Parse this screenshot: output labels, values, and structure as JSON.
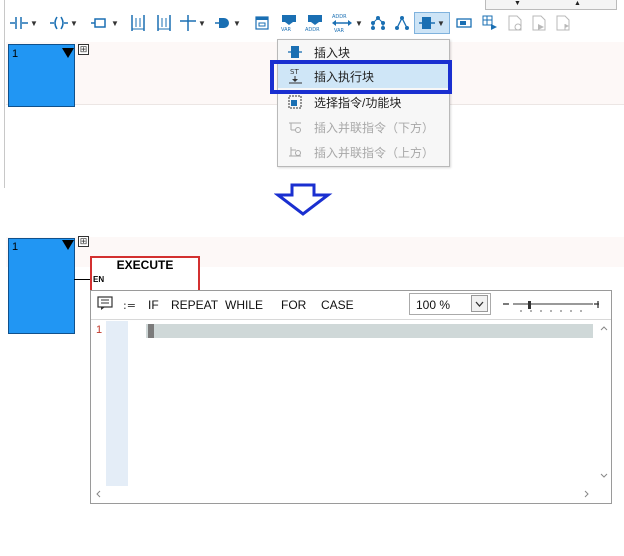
{
  "top": {
    "toolbar": {
      "icons": [
        {
          "name": "contact-icon",
          "glyph": "-| |-",
          "dropdown": true
        },
        {
          "name": "coil-icon",
          "glyph": "-( )-",
          "dropdown": true
        },
        {
          "name": "box-icon",
          "glyph": "▭",
          "dropdown": true
        },
        {
          "name": "parallel-branch-icon",
          "glyph": "|↓|",
          "dropdown": false
        },
        {
          "name": "parallel-branch-up-icon",
          "glyph": "|↑|",
          "dropdown": false
        },
        {
          "name": "branch-icon",
          "glyph": "┼",
          "dropdown": true
        },
        {
          "name": "function-block-icon",
          "glyph": "⊐",
          "dropdown": true
        },
        {
          "name": "window-icon",
          "glyph": "▣",
          "dropdown": false
        },
        {
          "name": "var-input-icon",
          "glyph": "VAR",
          "dropdown": false
        },
        {
          "name": "addr-input-icon",
          "glyph": "ADDR",
          "dropdown": false
        },
        {
          "name": "addr-var-icon",
          "glyph": "ADDR VAR",
          "dropdown": true
        },
        {
          "name": "network-icon",
          "glyph": "⁂",
          "dropdown": false
        },
        {
          "name": "tree-icon",
          "glyph": "⋀",
          "dropdown": false
        },
        {
          "name": "insert-block-icon",
          "glyph": "⊐",
          "dropdown": true,
          "active": true
        },
        {
          "name": "rectangle-icon",
          "glyph": "▭",
          "dropdown": false
        },
        {
          "name": "table-icon",
          "glyph": "▦",
          "dropdown": false
        },
        {
          "name": "doc-add-icon",
          "glyph": "▯",
          "dropdown": false,
          "disabled": true
        },
        {
          "name": "doc-arrow-icon",
          "glyph": "▯",
          "dropdown": false,
          "disabled": true
        },
        {
          "name": "doc-flag-icon",
          "glyph": "▯",
          "dropdown": false,
          "disabled": true
        }
      ]
    },
    "network": {
      "number": "1"
    },
    "menu": {
      "items": [
        {
          "label": "插入块",
          "icon": "block-icon",
          "disabled": false,
          "highlighted": false
        },
        {
          "label": "插入执行块",
          "icon": "st-block-icon",
          "disabled": false,
          "highlighted": true
        },
        {
          "label": "选择指令/功能块",
          "icon": "select-instruction-icon",
          "disabled": false,
          "highlighted": false
        },
        {
          "label": "插入并联指令（下方）",
          "icon": "parallel-below-icon",
          "disabled": true,
          "highlighted": false
        },
        {
          "label": "插入并联指令（上方）",
          "icon": "parallel-above-icon",
          "disabled": true,
          "highlighted": false
        }
      ]
    }
  },
  "bottom": {
    "network": {
      "number": "1"
    },
    "block": {
      "title": "EXECUTE",
      "pin": "EN"
    },
    "editor": {
      "keywords": [
        "IF",
        "REPEAT",
        "WHILE",
        "FOR",
        "CASE"
      ],
      "zoom": "100 %",
      "line_number": "1"
    }
  },
  "colors": {
    "network": "#2196f3",
    "highlight_border": "#1a2fd0",
    "block_border": "#d33030",
    "menu_highlight": "#cfe6f7"
  }
}
